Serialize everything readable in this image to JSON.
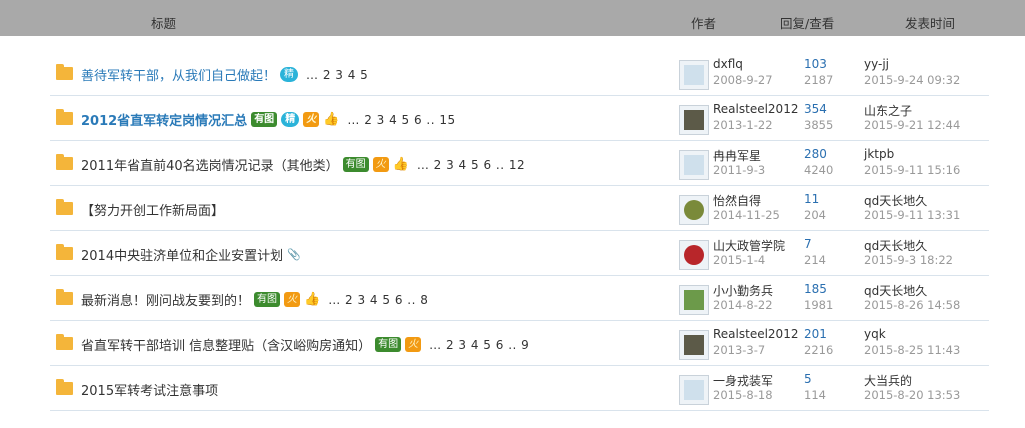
{
  "header": {
    "title": "标题",
    "author": "作者",
    "reply_view": "回复/查看",
    "post_time": "发表时间"
  },
  "rows": [
    {
      "title": "善待军转干部，从我们自己做起！",
      "badges": [
        "精"
      ],
      "pages": "… 2  3  4  5",
      "author": "dxflq",
      "adate": "2008-9-27",
      "replies": "103",
      "views": "2187",
      "last_by": "yy-jj",
      "last_time": "2015-9-24 09:32"
    },
    {
      "title": "2012省直军转定岗情况汇总",
      "badges": [
        "有图",
        "精",
        "火"
      ],
      "pages": "… 2  3  4  5  6 .. 15",
      "author": "Realsteel2012",
      "adate": "2013-1-22",
      "replies": "354",
      "views": "3855",
      "last_by": "山东之子",
      "last_time": "2015-9-21 12:44"
    },
    {
      "title": "2011年省直前40名选岗情况记录（其他类）",
      "badges": [
        "有图",
        "火"
      ],
      "pages": "… 2  3  4  5  6 .. 12",
      "author": "冉冉军星",
      "adate": "2011-9-3",
      "replies": "280",
      "views": "4240",
      "last_by": "jktpb",
      "last_time": "2015-9-11 15:16"
    },
    {
      "title": "【努力开创工作新局面】",
      "badges": [],
      "pages": "",
      "author": "怡然自得",
      "adate": "2014-11-25",
      "replies": "11",
      "views": "204",
      "last_by": "qd天长地久",
      "last_time": "2015-9-11 13:31"
    },
    {
      "title": "2014中央驻济单位和企业安置计划",
      "badges": [],
      "pages": "",
      "author": "山大政管学院",
      "adate": "2015-1-4",
      "replies": "7",
      "views": "214",
      "last_by": "qd天长地久",
      "last_time": "2015-9-3 18:22"
    },
    {
      "title": "最新消息！刚问战友要到的！",
      "badges": [
        "有图",
        "火"
      ],
      "pages": "… 2  3  4  5  6 .. 8",
      "author": "小小勤务兵",
      "adate": "2014-8-22",
      "replies": "185",
      "views": "1981",
      "last_by": "qd天长地久",
      "last_time": "2015-8-26 14:58"
    },
    {
      "title": "省直军转干部培训 信息整理贴（含汉峪购房通知）",
      "badges": [
        "有图",
        "火"
      ],
      "pages": "… 2  3  4  5  6 .. 9",
      "author": "Realsteel2012",
      "adate": "2013-3-7",
      "replies": "201",
      "views": "2216",
      "last_by": "yqk",
      "last_time": "2015-8-25 11:43"
    },
    {
      "title": "2015军转考试注意事项",
      "badges": [],
      "pages": "",
      "author": "一身戎装军",
      "adate": "2015-8-18",
      "replies": "5",
      "views": "114",
      "last_by": "大当兵的",
      "last_time": "2015-8-20 13:53"
    }
  ]
}
